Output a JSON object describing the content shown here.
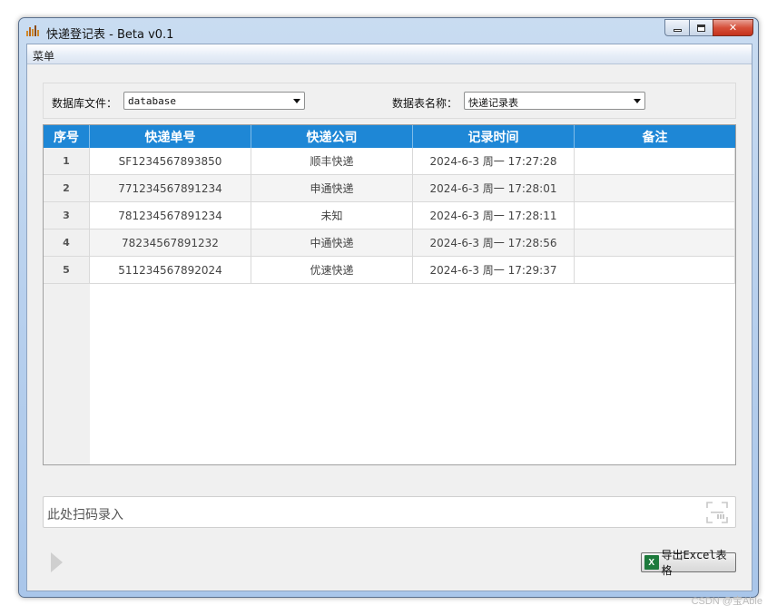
{
  "window": {
    "title": "快递登记表 - Beta v0.1"
  },
  "menubar": {
    "items": [
      "菜单"
    ]
  },
  "form": {
    "db_label": "数据库文件：",
    "db_value": "database",
    "table_label": "数据表名称：",
    "table_value": "快递记录表"
  },
  "grid": {
    "headers": [
      "序号",
      "快递单号",
      "快递公司",
      "记录时间",
      "备注"
    ],
    "rows": [
      {
        "idx": "1",
        "tracking": "SF1234567893850",
        "company": "顺丰快递",
        "time": "2024-6-3 周一 17:27:28",
        "note": ""
      },
      {
        "idx": "2",
        "tracking": "771234567891234",
        "company": "申通快递",
        "time": "2024-6-3 周一 17:28:01",
        "note": ""
      },
      {
        "idx": "3",
        "tracking": "781234567891234",
        "company": "未知",
        "time": "2024-6-3 周一 17:28:11",
        "note": ""
      },
      {
        "idx": "4",
        "tracking": "78234567891232",
        "company": "中通快递",
        "time": "2024-6-3 周一 17:28:56",
        "note": ""
      },
      {
        "idx": "5",
        "tracking": "511234567892024",
        "company": "优速快递",
        "time": "2024-6-3 周一 17:29:37",
        "note": ""
      }
    ]
  },
  "scan": {
    "placeholder": "此处扫码录入"
  },
  "export": {
    "label": "导出Excel表格"
  },
  "watermark": "CSDN @宝Able",
  "colors": {
    "header": "#1e87d6",
    "close": "#c4321c",
    "excel": "#1d7a3c"
  },
  "icons": [
    "app-icon",
    "minimize-icon",
    "maximize-icon",
    "close-icon",
    "dropdown-arrow-icon",
    "qr-scan-icon",
    "play-icon",
    "excel-icon"
  ]
}
